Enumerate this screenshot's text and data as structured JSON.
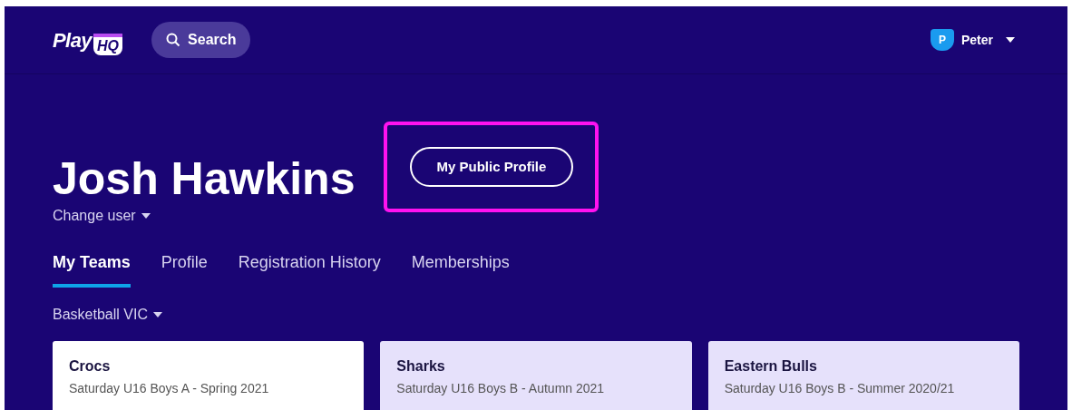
{
  "header": {
    "logo": {
      "text": "Play",
      "badge": "HQ"
    },
    "search": {
      "label": "Search"
    },
    "user": {
      "initial": "P",
      "name": "Peter"
    }
  },
  "profile": {
    "name": "Josh Hawkins",
    "public_profile_button": "My Public Profile",
    "highlighted": true,
    "change_user": "Change user"
  },
  "tabs": [
    {
      "label": "My Teams",
      "selected": true
    },
    {
      "label": "Profile",
      "selected": false
    },
    {
      "label": "Registration History",
      "selected": false
    },
    {
      "label": "Memberships",
      "selected": false
    }
  ],
  "organisation": "Basketball VIC",
  "teams": [
    {
      "name": "Crocs",
      "detail": "Saturday U16 Boys A - Spring 2021",
      "selected": true
    },
    {
      "name": "Sharks",
      "detail": "Saturday U16 Boys B - Autumn 2021",
      "selected": false
    },
    {
      "name": "Eastern Bulls",
      "detail": "Saturday U16 Boys B - Summer 2020/21",
      "selected": false
    }
  ]
}
